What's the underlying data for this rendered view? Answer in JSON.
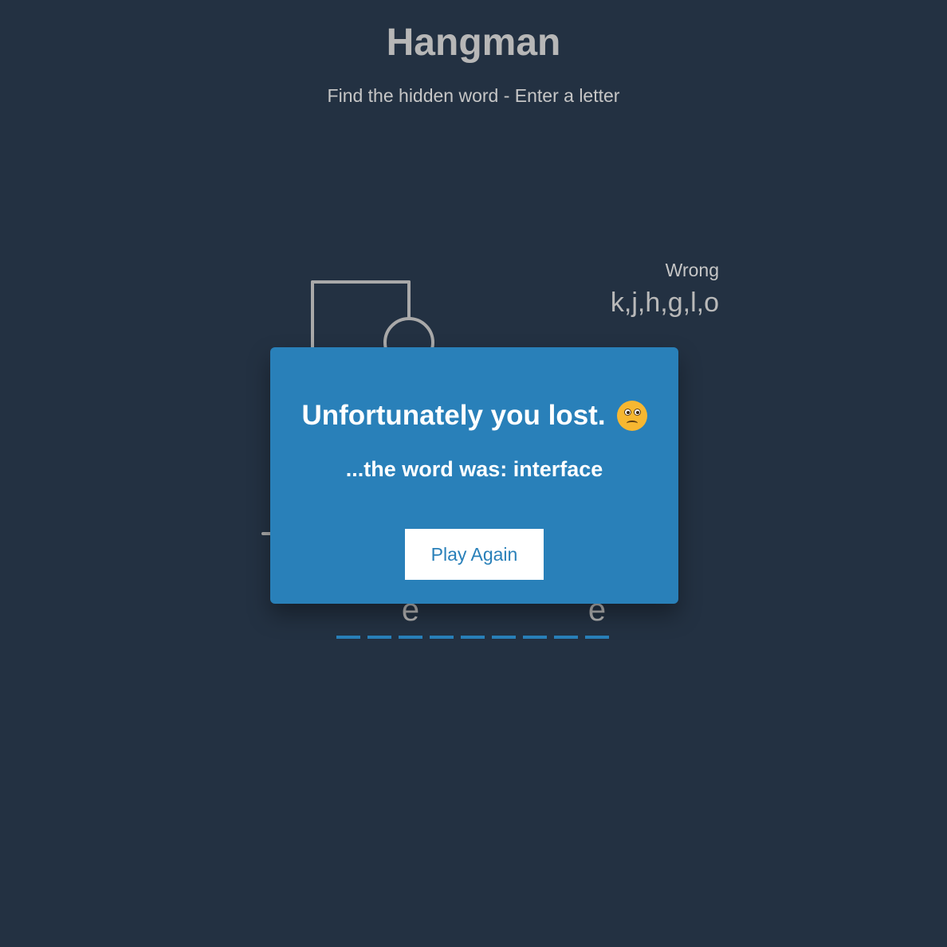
{
  "header": {
    "title": "Hangman",
    "subtitle": "Find the hidden word - Enter a letter"
  },
  "wrong": {
    "label": "Wrong",
    "letters": "k,j,h,g,l,o"
  },
  "word": {
    "slots": [
      "",
      "",
      "e",
      "",
      "",
      "",
      "",
      "",
      "e"
    ]
  },
  "popup": {
    "title": "Unfortunately you lost.",
    "emoji_icon": "confused-face-icon",
    "message": "...the word was: interface",
    "button_label": "Play Again"
  },
  "colors": {
    "background": "#233142",
    "accent": "#2980b9",
    "figure": "#a9a9a9"
  }
}
